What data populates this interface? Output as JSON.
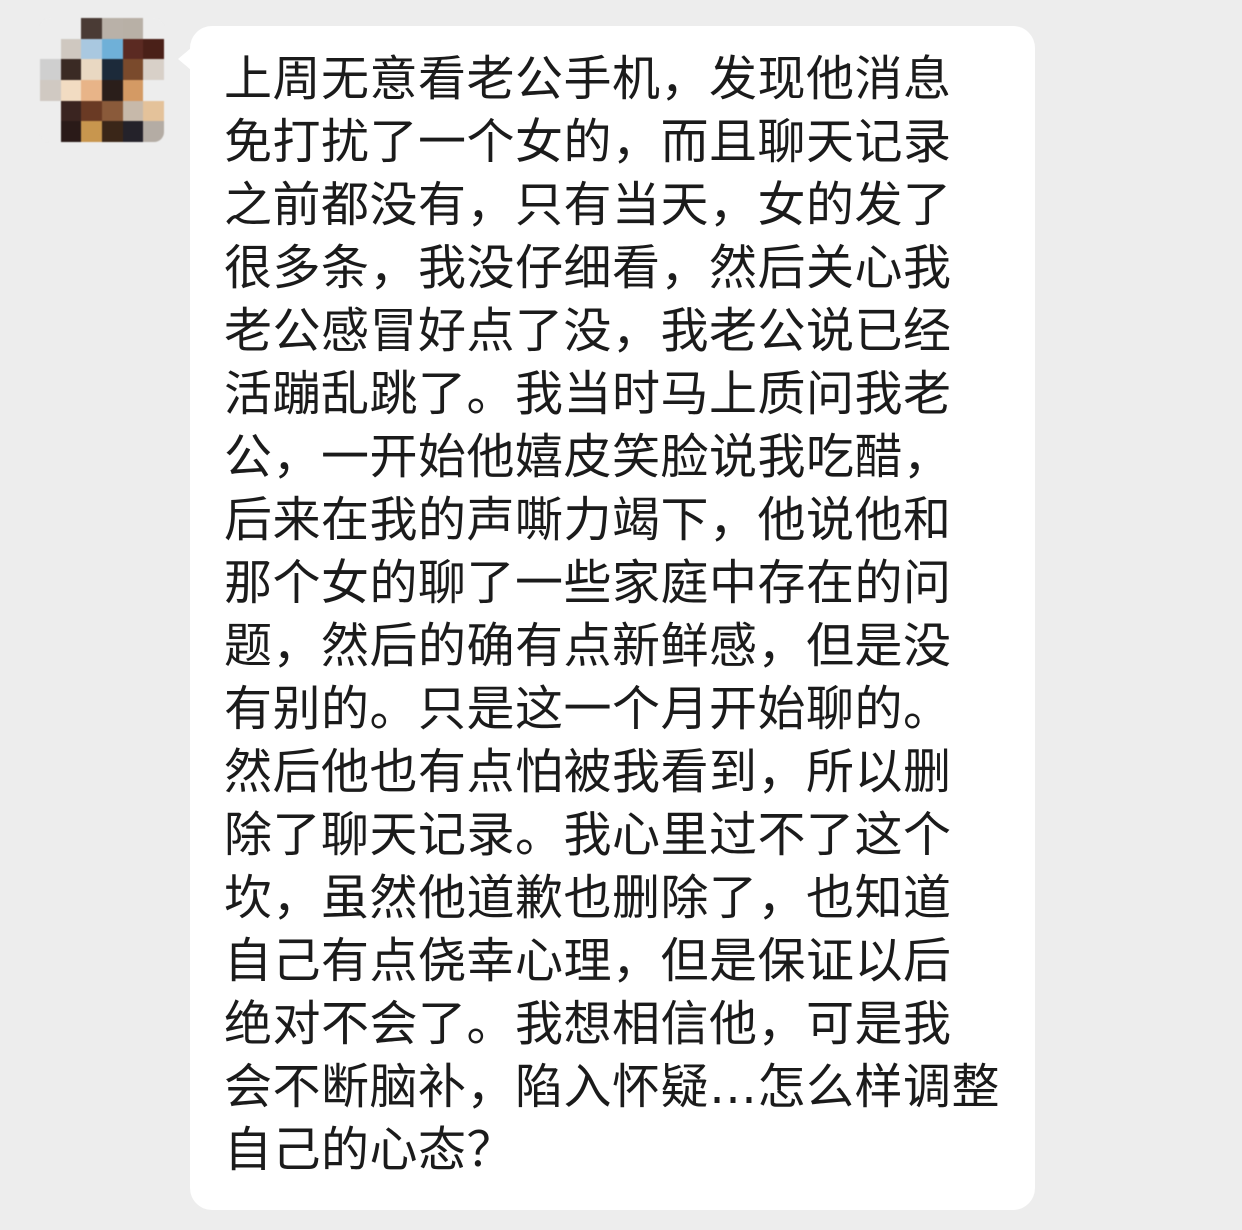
{
  "avatar": {
    "alt": "avatar (pixelated)",
    "pixels": [
      [
        "#ededed",
        "#ededed",
        "#4a3b35",
        "#b9b1a8",
        "#b8b0a6",
        "#ededed"
      ],
      [
        "#ededed",
        "#cfc8c0",
        "#a9c8e0",
        "#6fb0d8",
        "#5b2a22",
        "#4a2018"
      ],
      [
        "#cfcfcf",
        "#3a2a24",
        "#e9d8c2",
        "#1c2a3a",
        "#7a4a2c",
        "#d8d0c8"
      ],
      [
        "#d0c9c2",
        "#f2dcc2",
        "#e8b488",
        "#2a1e1a",
        "#d49a64",
        "#ededed"
      ],
      [
        "#ededed",
        "#3a2420",
        "#6a3a24",
        "#8a5a3a",
        "#c7b9aa",
        "#e4c29a"
      ],
      [
        "#ededed",
        "#2a1a18",
        "#c8964e",
        "#3a2618",
        "#24222a",
        "#b4aca4"
      ]
    ]
  },
  "message": {
    "lines": [
      "上周无意看老公手机，发现他消息",
      "免打扰了一个女的，而且聊天记录",
      "之前都没有，只有当天，女的发了",
      "很多条，我没仔细看，然后关心我",
      "老公感冒好点了没，我老公说已经",
      "活蹦乱跳了。我当时马上质问我老",
      "公，一开始他嬉皮笑脸说我吃醋，",
      "后来在我的声嘶力竭下，他说他和",
      "那个女的聊了一些家庭中存在的问",
      "题，然后的确有点新鲜感，但是没",
      "有别的。只是这一个月开始聊的。",
      "然后他也有点怕被我看到，所以删",
      "除了聊天记录。我心里过不了这个",
      "坎，虽然他道歉也删除了，也知道",
      "自己有点侥幸心理，但是保证以后",
      "绝对不会了。我想相信他，可是我",
      "会不断脑补，陷入怀疑…怎么样调整",
      "自己的心态？"
    ]
  }
}
